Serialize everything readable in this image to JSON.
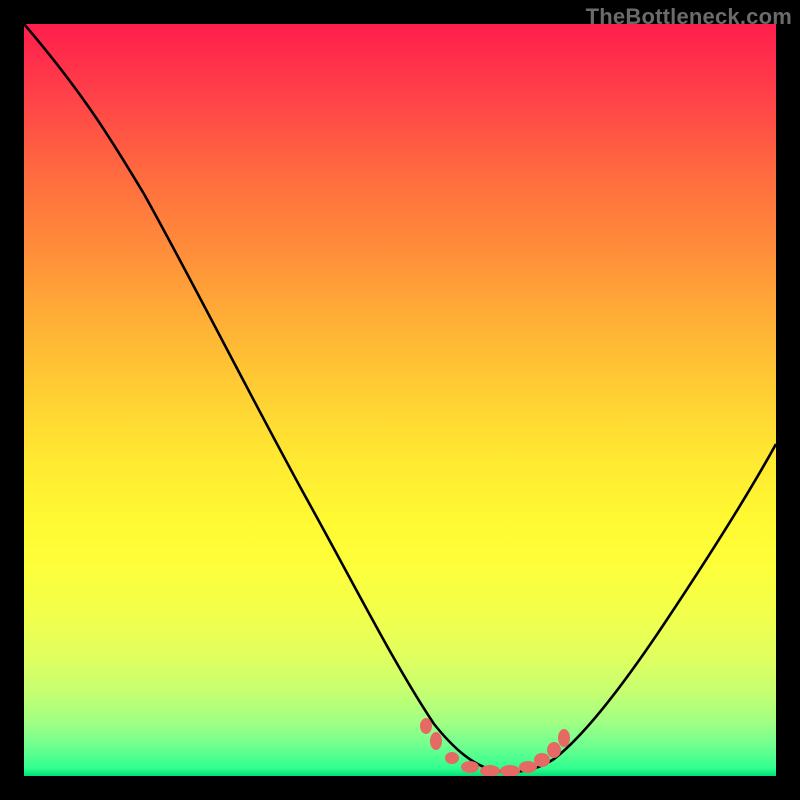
{
  "watermark": "TheBottleneck.com",
  "chart_data": {
    "type": "line",
    "title": "",
    "xlabel": "",
    "ylabel": "",
    "x_range": [
      0,
      100
    ],
    "y_range": [
      0,
      100
    ],
    "series": [
      {
        "name": "bottleneck-curve",
        "color": "#000000",
        "x": [
          0,
          5,
          10,
          15,
          20,
          25,
          30,
          35,
          40,
          45,
          50,
          53,
          55,
          58,
          60,
          63,
          65,
          68,
          70,
          75,
          80,
          85,
          90,
          95,
          100
        ],
        "y": [
          100,
          92,
          85,
          79,
          70,
          60,
          50,
          40,
          30,
          20,
          11,
          7,
          4,
          2,
          1,
          1,
          1,
          2,
          4,
          10,
          18,
          27,
          36,
          44,
          52
        ]
      },
      {
        "name": "optimal-range-marker",
        "color": "#e46a63",
        "type": "scatter",
        "x": [
          53,
          55,
          58,
          60,
          62,
          64,
          66,
          68,
          69,
          70
        ],
        "y": [
          6,
          3.5,
          2,
          1.2,
          1,
          1,
          1.2,
          2,
          3,
          4.5
        ]
      }
    ],
    "background_gradient": {
      "top": "#ff1e4c",
      "mid": "#ffe932",
      "bottom": "#00e076"
    }
  }
}
